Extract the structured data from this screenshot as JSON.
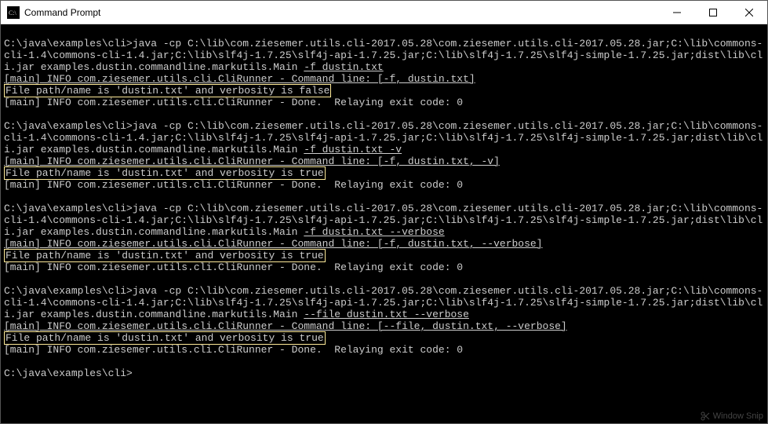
{
  "window": {
    "title": "Command Prompt"
  },
  "term": {
    "blank": " ",
    "prompt1": "C:\\java\\examples\\cli>java -cp C:\\lib\\com.ziesemer.utils.cli-2017.05.28\\com.ziesemer.utils.cli-2017.05.28.jar;C:\\lib\\commons-cli-1.4\\commons-cli-1.4.jar;C:\\lib\\slf4j-1.7.25\\slf4j-api-1.7.25.jar;C:\\lib\\slf4j-1.7.25\\slf4j-simple-1.7.25.jar;dist\\lib\\cli.jar examples.dustin.commandline.markutils.Main ",
    "arg1": "-f dustin.txt",
    "info1a": "[main] INFO com.ziesemer.utils.cli.CliRunner - Command line: [-f, dustin.txt]",
    "info1b": "File path/name is 'dustin.txt' and verbosity is false",
    "info1c": "[main] INFO com.ziesemer.utils.cli.CliRunner - Done.  Relaying exit code: 0",
    "prompt2": "C:\\java\\examples\\cli>java -cp C:\\lib\\com.ziesemer.utils.cli-2017.05.28\\com.ziesemer.utils.cli-2017.05.28.jar;C:\\lib\\commons-cli-1.4\\commons-cli-1.4.jar;C:\\lib\\slf4j-1.7.25\\slf4j-api-1.7.25.jar;C:\\lib\\slf4j-1.7.25\\slf4j-simple-1.7.25.jar;dist\\lib\\cli.jar examples.dustin.commandline.markutils.Main ",
    "arg2": "-f dustin.txt -v",
    "info2a": "[main] INFO com.ziesemer.utils.cli.CliRunner - Command line: [-f, dustin.txt, -v]",
    "info2b": "File path/name is 'dustin.txt' and verbosity is true",
    "info2c": "[main] INFO com.ziesemer.utils.cli.CliRunner - Done.  Relaying exit code: 0",
    "prompt3": "C:\\java\\examples\\cli>java -cp C:\\lib\\com.ziesemer.utils.cli-2017.05.28\\com.ziesemer.utils.cli-2017.05.28.jar;C:\\lib\\commons-cli-1.4\\commons-cli-1.4.jar;C:\\lib\\slf4j-1.7.25\\slf4j-api-1.7.25.jar;C:\\lib\\slf4j-1.7.25\\slf4j-simple-1.7.25.jar;dist\\lib\\cli.jar examples.dustin.commandline.markutils.Main ",
    "arg3": "-f dustin.txt --verbose",
    "info3a": "[main] INFO com.ziesemer.utils.cli.CliRunner - Command line: [-f, dustin.txt, --verbose]",
    "info3b": "File path/name is 'dustin.txt' and verbosity is true",
    "info3c": "[main] INFO com.ziesemer.utils.cli.CliRunner - Done.  Relaying exit code: 0",
    "prompt4": "C:\\java\\examples\\cli>java -cp C:\\lib\\com.ziesemer.utils.cli-2017.05.28\\com.ziesemer.utils.cli-2017.05.28.jar;C:\\lib\\commons-cli-1.4\\commons-cli-1.4.jar;C:\\lib\\slf4j-1.7.25\\slf4j-api-1.7.25.jar;C:\\lib\\slf4j-1.7.25\\slf4j-simple-1.7.25.jar;dist\\lib\\cli.jar examples.dustin.commandline.markutils.Main ",
    "arg4": "--file dustin.txt --verbose",
    "info4a": "[main] INFO com.ziesemer.utils.cli.CliRunner - Command line: [--file, dustin.txt, --verbose]",
    "info4b": "File path/name is 'dustin.txt' and verbosity is true",
    "info4c": "[main] INFO com.ziesemer.utils.cli.CliRunner - Done.  Relaying exit code: 0",
    "final_prompt": "C:\\java\\examples\\cli>"
  },
  "watermark": "Window Snip"
}
